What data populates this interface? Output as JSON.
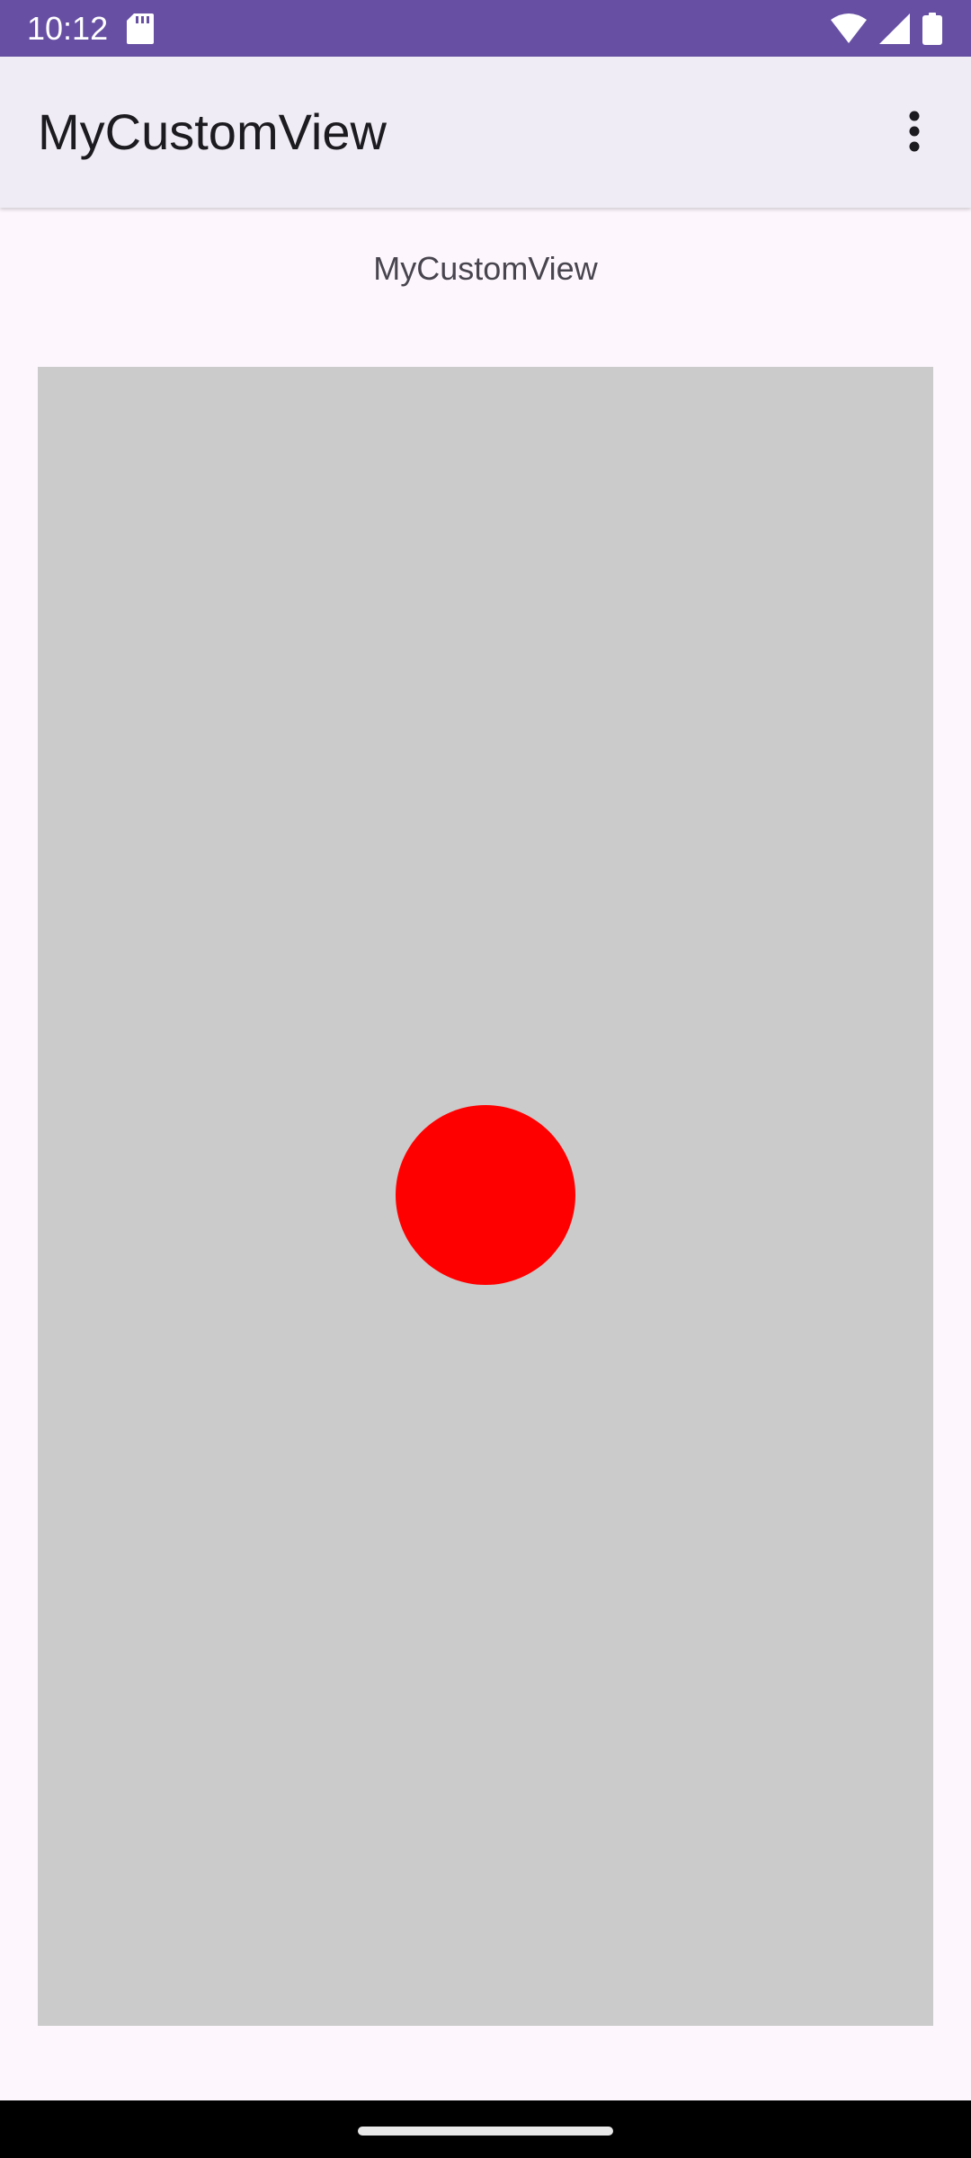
{
  "status_bar": {
    "time": "10:12",
    "icons": [
      "sd-card-icon",
      "wifi-icon",
      "signal-icon",
      "battery-icon"
    ],
    "background": "#6750a4"
  },
  "app_bar": {
    "title": "MyCustomView",
    "menu_icon": "more-vert-icon",
    "background": "#f0ecf5"
  },
  "content": {
    "title": "MyCustomView"
  },
  "custom_view": {
    "background": "#cbcbcb",
    "circle_color": "#ff0000"
  },
  "nav_bar": {
    "handle_icon": "gesture-handle",
    "background": "#000000"
  }
}
